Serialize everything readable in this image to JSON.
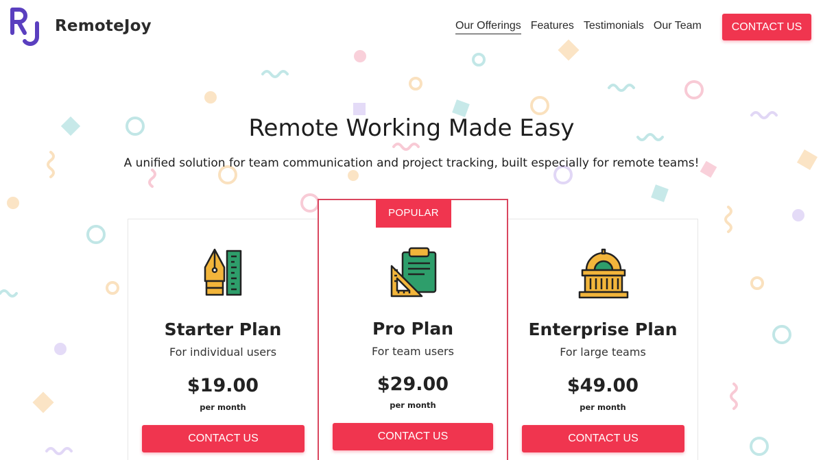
{
  "brand": {
    "logo_text": "RJ",
    "name": "RemoteJoy"
  },
  "nav": {
    "items": [
      {
        "label": "Our Offerings",
        "active": true
      },
      {
        "label": "Features"
      },
      {
        "label": "Testimonials"
      },
      {
        "label": "Our Team"
      }
    ],
    "cta_label": "CONTACT US"
  },
  "hero": {
    "title": "Remote Working Made Easy",
    "subtitle": "A unified solution for team communication and project tracking, built especially for remote teams!"
  },
  "plans": [
    {
      "name": "Starter Plan",
      "description": "For individual users",
      "price": "$19.00",
      "period": "per month",
      "cta": "CONTACT US",
      "icon": "pen-ruler-icon"
    },
    {
      "name": "Pro Plan",
      "description": "For team users",
      "price": "$29.00",
      "period": "per month",
      "cta": "CONTACT US",
      "icon": "clipboard-set-square-icon",
      "badge": "POPULAR",
      "popular": true
    },
    {
      "name": "Enterprise Plan",
      "description": "For large teams",
      "price": "$49.00",
      "period": "per month",
      "cta": "CONTACT US",
      "icon": "building-icon"
    }
  ],
  "colors": {
    "accent": "#f0354f",
    "logo": "#5a3fbf",
    "popular_border": "#d9465e"
  }
}
